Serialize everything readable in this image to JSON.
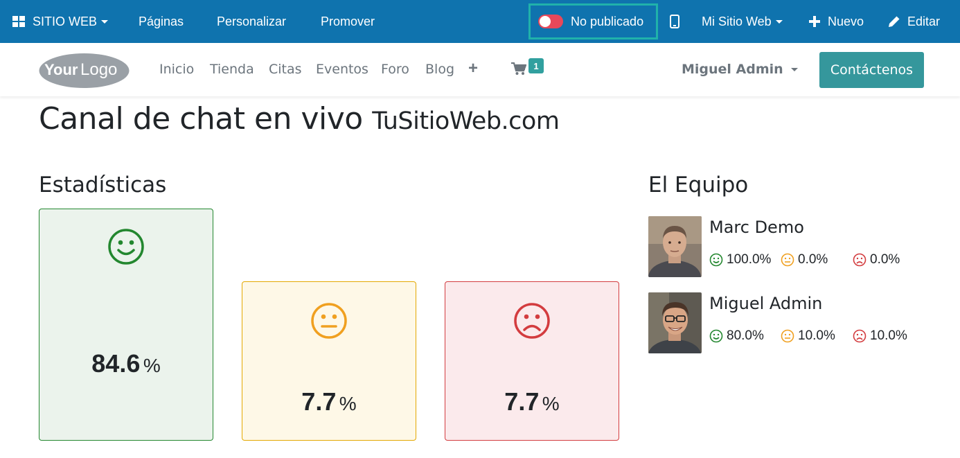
{
  "admin_bar": {
    "website_menu": "SITIO WEB",
    "pages": "Páginas",
    "customize": "Personalizar",
    "promote": "Promover",
    "publish_status": "No publicado",
    "site_selector": "Mi Sitio Web",
    "new": "Nuevo",
    "edit": "Editar"
  },
  "navbar": {
    "logo_text_bold": "Your",
    "logo_text_light": "Logo",
    "links": [
      "Inicio",
      "Tienda",
      "Citas",
      "Eventos",
      "Foro",
      "Blog"
    ],
    "cart_count": "1",
    "user": "Miguel Admin",
    "contact_button": "Contáctenos"
  },
  "page": {
    "title": "Canal de chat en vivo",
    "site_name": "TuSitioWeb.com",
    "stats_heading": "Estadísticas",
    "team_heading": "El Equipo"
  },
  "stats": {
    "happy": {
      "value": "84.6",
      "unit": "%"
    },
    "neutral": {
      "value": "7.7",
      "unit": "%"
    },
    "sad": {
      "value": "7.7",
      "unit": "%"
    }
  },
  "team": [
    {
      "name": "Marc Demo",
      "happy": "100.0%",
      "neutral": "0.0%",
      "sad": "0.0%"
    },
    {
      "name": "Miguel Admin",
      "happy": "80.0%",
      "neutral": "10.0%",
      "sad": "10.0%"
    }
  ],
  "colors": {
    "admin_bar": "#0f73ae",
    "publish_highlight": "#20b2aa",
    "toggle_off": "#e8485a",
    "accent": "#35979c",
    "happy": "#23872f",
    "neutral": "#f0a020",
    "sad": "#d33c3f"
  },
  "icons": {
    "website_menu": "apps-grid-icon",
    "mobile_preview": "mobile-phone-icon",
    "new": "plus-icon",
    "edit": "pencil-icon",
    "add_menu": "plus-icon",
    "cart": "shopping-cart-icon",
    "happy": "smile-icon",
    "neutral": "meh-icon",
    "sad": "frown-icon"
  }
}
